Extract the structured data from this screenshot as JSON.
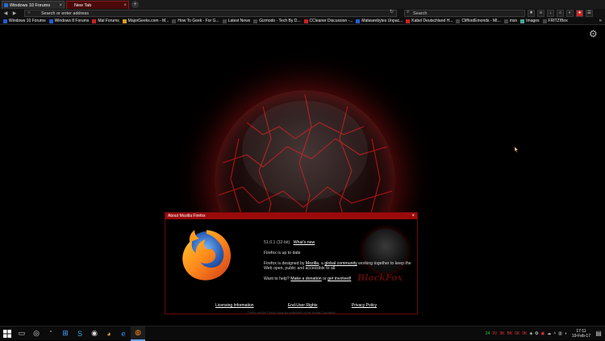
{
  "tabs": [
    {
      "label": "Windows 10 Forums",
      "active": false
    },
    {
      "label": "New Tab",
      "active": true
    }
  ],
  "nav": {
    "url_placeholder": "Search or enter address",
    "search_placeholder": "Search"
  },
  "bookmarks": [
    "Windows 10 Forums",
    "Windows 8 Forums",
    "Mal Forums",
    "MajorGeeks.com - M...",
    "How To Geek - For G...",
    "Latest News",
    "Gizmodo - Tech By D...",
    "CCleaner Discussion -...",
    "Malwarebytes Unpac...",
    "Kabel Deutschland H...",
    "CliffordEmonds - MI...",
    "msn",
    "Images",
    "FRITZ!Box"
  ],
  "about": {
    "title": "About Mozilla Firefox",
    "version": "51.0.1 (32-bit)",
    "whats_new": "What's new",
    "status": "Firefox is up to date",
    "designed_prefix": "Firefox is designed by",
    "mozilla": "Mozilla",
    "designed_mid": ", a",
    "global_community": "global community",
    "designed_suffix": "working together to keep the Web open, public and accessible to all.",
    "help_prefix": "Want to help?",
    "donation": "Make a donation",
    "or": "or",
    "get_involved": "get involved!",
    "links": [
      "Licensing Information",
      "End-User Rights",
      "Privacy Policy"
    ],
    "footer": "Firefox and the Firefox logos are trademarks of the Mozilla Foundation.",
    "watermark": "BlackFox"
  },
  "taskbar": {
    "tray_items": [
      "24",
      "3V",
      "3K",
      "BK",
      "0K",
      "0K"
    ],
    "time": "17:11",
    "date": "19-Feb-17"
  },
  "colors": {
    "accent_red": "#9b0a0a",
    "background": "#000000"
  }
}
